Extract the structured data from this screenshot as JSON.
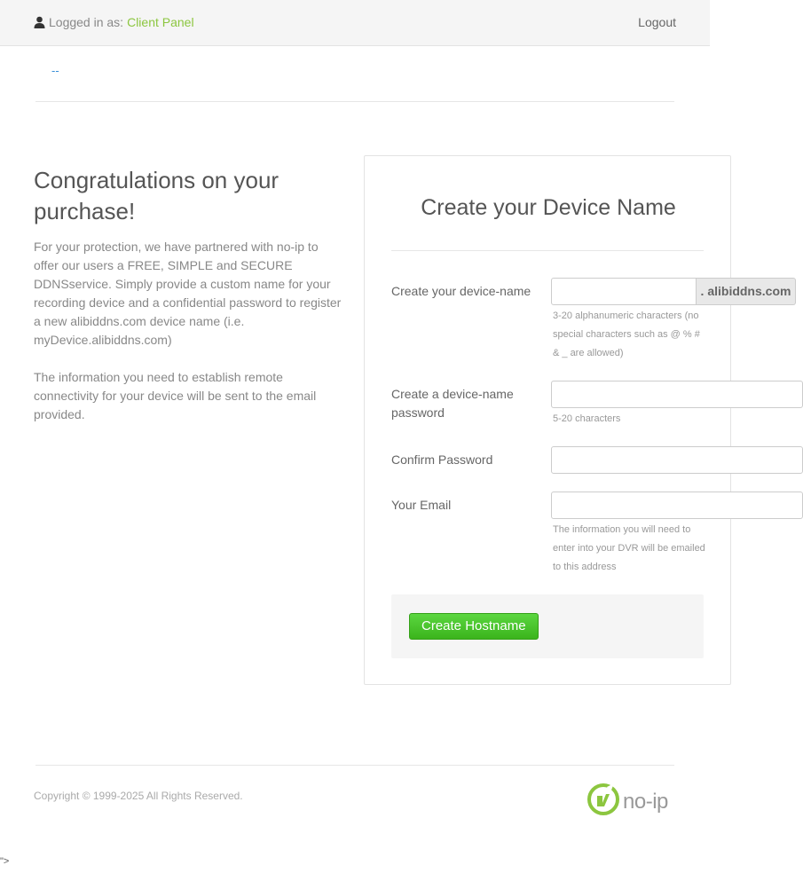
{
  "topbar": {
    "logged_in_label": "Logged in as:",
    "client_link": "Client Panel",
    "logout": "Logout"
  },
  "nav": {
    "dash_link": "--"
  },
  "intro": {
    "title": "Congratulations on your purchase!",
    "paragraph1": "For your protection, we have partnered with no-ip to offer our users a FREE, SIMPLE and SECURE DDNSservice. Simply provide a custom name for your recording device and a confidential password to register a new alibiddns.com device name (i.e. myDevice.alibiddns.com)",
    "paragraph2": "The information you need to establish remote connectivity for your device will be sent to the email provided."
  },
  "form": {
    "title": "Create your Device Name",
    "device_name": {
      "label": "Create your device-name",
      "value": "",
      "addon": ". alibiddns.com",
      "help": "3-20 alphanumeric characters (no special characters such as @ % # & _ are allowed)"
    },
    "password": {
      "label": "Create a device-name password",
      "value": "",
      "help": "5-20 characters"
    },
    "confirm": {
      "label": "Confirm Password",
      "value": ""
    },
    "email": {
      "label": "Your Email",
      "value": "",
      "help": "The information you will need to enter into your DVR will be emailed to this address"
    },
    "submit_label": "Create Hostname"
  },
  "footer": {
    "copyright": "Copyright © 1999-2025 All Rights Reserved.",
    "logo_text": "no-ip"
  },
  "stray_text": "\">",
  "colors": {
    "accent_green": "#8cc63f",
    "button_green": "#3bb41c",
    "link_blue": "#3a8fd8"
  },
  "icons": [
    "user-icon",
    "noip-logo-icon"
  ]
}
